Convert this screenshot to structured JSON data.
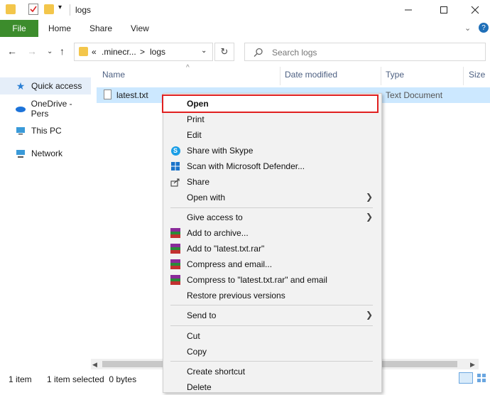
{
  "window": {
    "title": "logs"
  },
  "ribbon": {
    "tabs": [
      "File",
      "Home",
      "Share",
      "View"
    ]
  },
  "address": {
    "path_prefix": "«",
    "segment1": ".minecr...",
    "separator": ">",
    "segment2": "logs"
  },
  "search": {
    "placeholder": "Search logs"
  },
  "nav": {
    "items": [
      "Quick access",
      "OneDrive - Pers",
      "This PC",
      "Network"
    ]
  },
  "columns": {
    "name": "Name",
    "date": "Date modified",
    "type": "Type",
    "size": "Size"
  },
  "files": [
    {
      "name": "latest.txt",
      "date": "",
      "type": "Text Document"
    }
  ],
  "status": {
    "count": "1 item",
    "selected": "1 item selected  0 bytes"
  },
  "context_menu": {
    "open": "Open",
    "print": "Print",
    "edit": "Edit",
    "share_skype": "Share with Skype",
    "scan_defender": "Scan with Microsoft Defender...",
    "share": "Share",
    "open_with": "Open with",
    "give_access": "Give access to",
    "add_archive": "Add to archive...",
    "add_rar": "Add to \"latest.txt.rar\"",
    "compress_email": "Compress and email...",
    "compress_rar_email": "Compress to \"latest.txt.rar\" and email",
    "restore_versions": "Restore previous versions",
    "send_to": "Send to",
    "cut": "Cut",
    "copy": "Copy",
    "create_shortcut": "Create shortcut",
    "delete_partial": "Delete"
  },
  "colors": {
    "accent": "#1f6fb8",
    "file_tab": "#3c8c2c",
    "selection": "#cce8ff",
    "highlight_border": "#e02020"
  }
}
